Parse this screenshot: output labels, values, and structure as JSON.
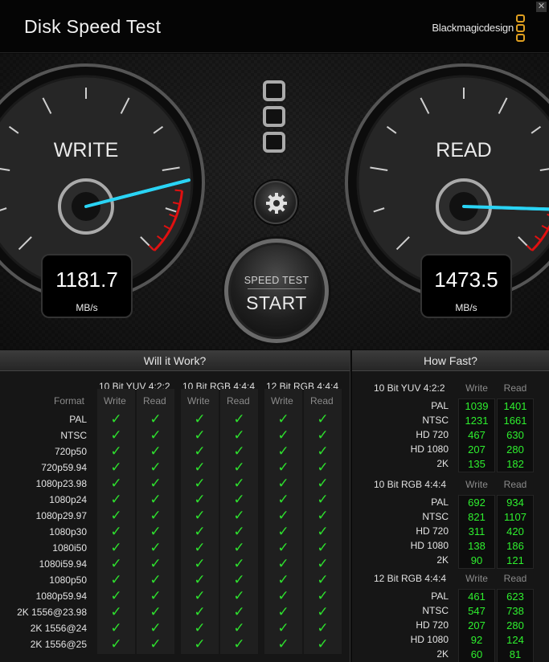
{
  "window": {
    "title": "Disk Speed Test",
    "brand": "Blackmagicdesign",
    "close_glyph": "✕"
  },
  "gauges": {
    "write": {
      "label": "WRITE",
      "value": "1181.7",
      "unit": "MB/s",
      "level": 0.78
    },
    "read": {
      "label": "READ",
      "value": "1473.5",
      "unit": "MB/s",
      "level": 0.84
    }
  },
  "controls": {
    "speed_test_label": "SPEED TEST",
    "start_label": "START",
    "settings_icon": "gear-icon",
    "config_icon": "storage-config-icon"
  },
  "will_it_work": {
    "title": "Will it Work?",
    "format_header": "Format",
    "groups": [
      "10 Bit YUV 4:2:2",
      "10 Bit RGB 4:4:4",
      "12 Bit RGB 4:4:4"
    ],
    "col_write": "Write",
    "col_read": "Read",
    "check_glyph": "✓",
    "formats": [
      "PAL",
      "NTSC",
      "720p50",
      "720p59.94",
      "1080p23.98",
      "1080p24",
      "1080p29.97",
      "1080p30",
      "1080i50",
      "1080i59.94",
      "1080p50",
      "1080p59.94",
      "2K 1556@23.98",
      "2K 1556@24",
      "2K 1556@25"
    ]
  },
  "how_fast": {
    "title": "How Fast?",
    "col_write": "Write",
    "col_read": "Read",
    "groups": [
      {
        "name": "10 Bit YUV 4:2:2",
        "rows": [
          {
            "format": "PAL",
            "write": "1039",
            "read": "1401"
          },
          {
            "format": "NTSC",
            "write": "1231",
            "read": "1661"
          },
          {
            "format": "HD 720",
            "write": "467",
            "read": "630"
          },
          {
            "format": "HD 1080",
            "write": "207",
            "read": "280"
          },
          {
            "format": "2K",
            "write": "135",
            "read": "182"
          }
        ]
      },
      {
        "name": "10 Bit RGB 4:4:4",
        "rows": [
          {
            "format": "PAL",
            "write": "692",
            "read": "934"
          },
          {
            "format": "NTSC",
            "write": "821",
            "read": "1107"
          },
          {
            "format": "HD 720",
            "write": "311",
            "read": "420"
          },
          {
            "format": "HD 1080",
            "write": "138",
            "read": "186"
          },
          {
            "format": "2K",
            "write": "90",
            "read": "121"
          }
        ]
      },
      {
        "name": "12 Bit RGB 4:4:4",
        "rows": [
          {
            "format": "PAL",
            "write": "461",
            "read": "623"
          },
          {
            "format": "NTSC",
            "write": "547",
            "read": "738"
          },
          {
            "format": "HD 720",
            "write": "207",
            "read": "280"
          },
          {
            "format": "HD 1080",
            "write": "92",
            "read": "124"
          },
          {
            "format": "2K",
            "write": "60",
            "read": "81"
          }
        ]
      }
    ]
  }
}
